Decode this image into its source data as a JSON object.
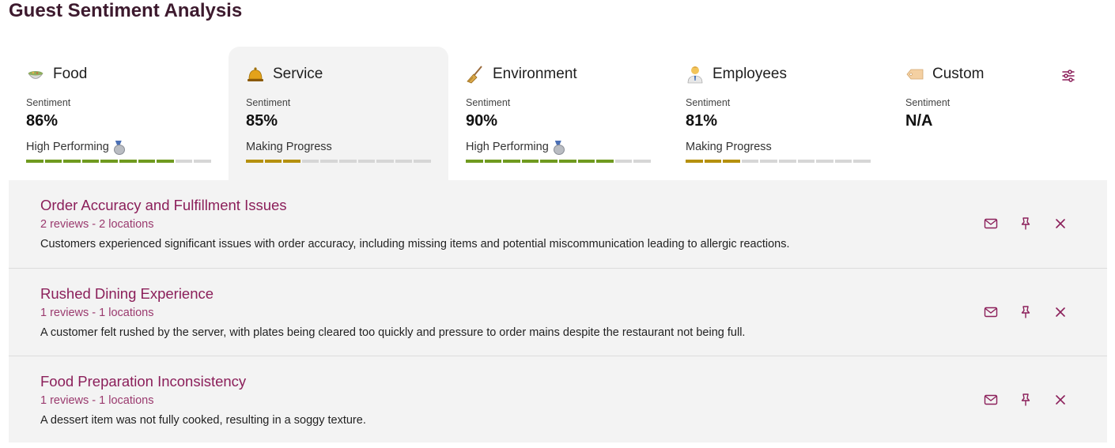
{
  "page": {
    "title": "Guest Sentiment Analysis"
  },
  "colors": {
    "accent": "#8b1f5a",
    "title": "#3d1a2e",
    "high": "#6f9a1f",
    "progress": "#b5900e"
  },
  "categories": [
    {
      "name": "Food",
      "icon": "bowl-icon",
      "sentiment_label": "Sentiment",
      "sentiment": "86%",
      "status": "High Performing",
      "filled": 8,
      "segments": 10,
      "tone": "green",
      "medal": true
    },
    {
      "name": "Service",
      "icon": "bell-icon",
      "sentiment_label": "Sentiment",
      "sentiment": "85%",
      "status": "Making Progress",
      "filled": 3,
      "segments": 10,
      "tone": "gold",
      "medal": false,
      "active": true
    },
    {
      "name": "Environment",
      "icon": "broom-icon",
      "sentiment_label": "Sentiment",
      "sentiment": "90%",
      "status": "High Performing",
      "filled": 8,
      "segments": 10,
      "tone": "green",
      "medal": true
    },
    {
      "name": "Employees",
      "icon": "employee-icon",
      "sentiment_label": "Sentiment",
      "sentiment": "81%",
      "status": "Making Progress",
      "filled": 3,
      "segments": 10,
      "tone": "gold",
      "medal": false
    },
    {
      "name": "Custom",
      "icon": "tag-icon",
      "sentiment_label": "Sentiment",
      "sentiment": "N/A",
      "status": "",
      "filled": 0,
      "segments": 0,
      "tone": "none",
      "medal": false
    }
  ],
  "insights": [
    {
      "title": "Order Accuracy and Fulfillment Issues",
      "meta": "2 reviews - 2 locations",
      "description": "Customers experienced significant issues with order accuracy, including missing items and potential miscommunication leading to allergic reactions."
    },
    {
      "title": "Rushed Dining Experience",
      "meta": "1 reviews - 1 locations",
      "description": "A customer felt rushed by the server, with plates being cleared too quickly and pressure to order mains despite the restaurant not being full."
    },
    {
      "title": "Food Preparation Inconsistency",
      "meta": "1 reviews - 1 locations",
      "description": "A dessert item was not fully cooked, resulting in a soggy texture."
    }
  ]
}
